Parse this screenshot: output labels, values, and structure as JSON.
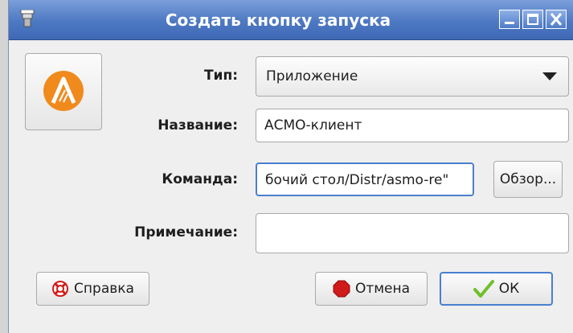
{
  "window": {
    "title": "Создать кнопку запуска"
  },
  "form": {
    "type_label": "Тип:",
    "type_value": "Приложение",
    "name_label": "Название:",
    "name_value": "АСМО-клиент",
    "command_label": "Команда:",
    "command_value": "бочий стол/Distr/asmo-re\"",
    "comment_label": "Примечание:",
    "comment_value": ""
  },
  "buttons": {
    "browse": "Обзор...",
    "help": "Справка",
    "cancel": "Отмена",
    "ok": "ОК"
  },
  "icons": {
    "window_icon": "launcher-icon",
    "app_logo": "asmo-logo-icon",
    "help_icon": "lifebuoy-icon",
    "cancel_icon": "stop-icon",
    "ok_icon": "checkmark-icon"
  },
  "colors": {
    "titlebar": "#4d78c2",
    "logo": "#f08a1c",
    "cancel_red": "#d11a1a",
    "ok_green": "#6fbf2c",
    "focus_border": "#4a7fd0"
  }
}
